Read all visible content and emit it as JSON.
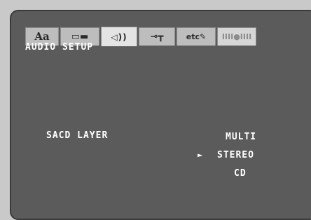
{
  "tabs": [
    {
      "name": "language",
      "glyph": "Aa"
    },
    {
      "name": "display",
      "glyph": "▭▬"
    },
    {
      "name": "audio",
      "glyph": "◁))"
    },
    {
      "name": "parental",
      "glyph": "⊸┳"
    },
    {
      "name": "etc",
      "glyph": "etc✎"
    },
    {
      "name": "timer",
      "glyph": "IIII●IIII"
    }
  ],
  "screen": {
    "title": "AUDIO SETUP",
    "setting_label": "SACD LAYER",
    "options": [
      {
        "label": "MULTI",
        "selected": false
      },
      {
        "label": "STEREO",
        "selected": true
      },
      {
        "label": "CD",
        "selected": false
      }
    ],
    "cursor": "►"
  },
  "colors": {
    "background": "#5b5b5b",
    "outer": "#c9c9c9",
    "tab": "#bdbdbd",
    "tab_active": "#e4e4e4",
    "text": "#ffffff"
  }
}
